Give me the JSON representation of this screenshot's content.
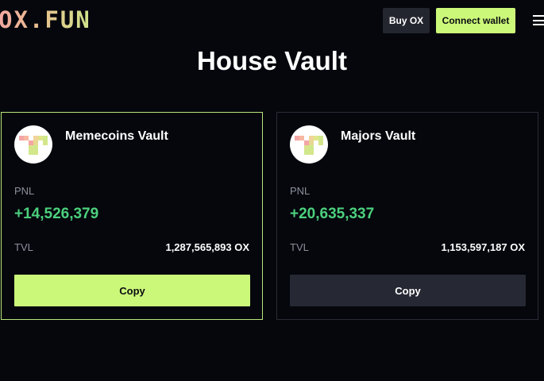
{
  "header": {
    "logo_text": "OX.FUN",
    "buy_label": "Buy OX",
    "connect_label": "Connect wallet",
    "menu_icon": "hamburger-menu-icon"
  },
  "page": {
    "title": "House Vault"
  },
  "vaults": [
    {
      "name": "Memecoins Vault",
      "pnl_label": "PNL",
      "pnl_value": "+14,526,379",
      "tvl_label": "TVL",
      "tvl_value": "1,287,565,893 OX",
      "copy_label": "Copy",
      "selected": true
    },
    {
      "name": "Majors Vault",
      "pnl_label": "PNL",
      "pnl_value": "+20,635,337",
      "tvl_label": "TVL",
      "tvl_value": "1,153,597,187 OX",
      "copy_label": "Copy",
      "selected": false
    }
  ],
  "colors": {
    "background": "#05070d",
    "accent": "#ccf87a",
    "positive": "#4cd07d",
    "muted": "#8c8f99",
    "secondary_button": "#24262f"
  }
}
